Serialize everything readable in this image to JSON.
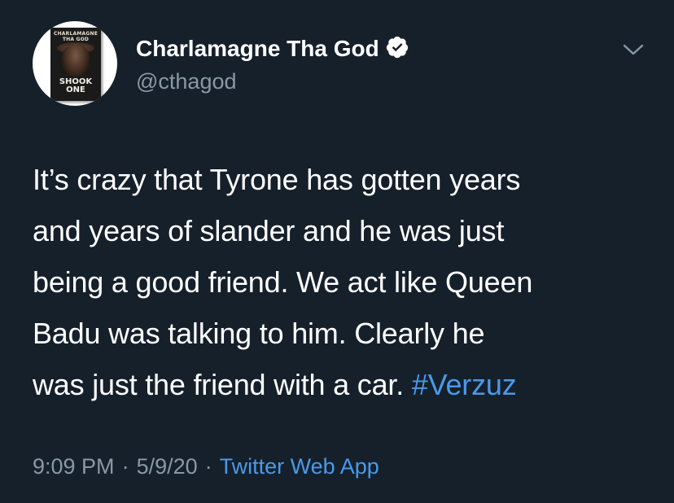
{
  "tweet": {
    "user": {
      "display_name": "Charlamagne Tha God",
      "handle": "@cthagod",
      "verified": true,
      "avatar": {
        "book_author": "CHARLAMAGNE THA GOD",
        "book_title": "SHOOK ONE"
      }
    },
    "text_before_hashtag": "It’s crazy that Tyrone has gotten years\nand years of slander and he was just\nbeing a good friend. We act like Queen\nBadu was talking to him. Clearly he\nwas just the friend with a car. ",
    "hashtag": "#Verzuz",
    "time": "9:09 PM",
    "date": "5/9/20",
    "separator": "·",
    "source": "Twitter Web App"
  },
  "icons": {
    "verified": "verified-badge-icon",
    "more": "chevron-down-icon"
  },
  "colors": {
    "background": "#15202b",
    "text": "#ffffff",
    "secondary": "#8899a6",
    "link": "#4a99e9"
  }
}
